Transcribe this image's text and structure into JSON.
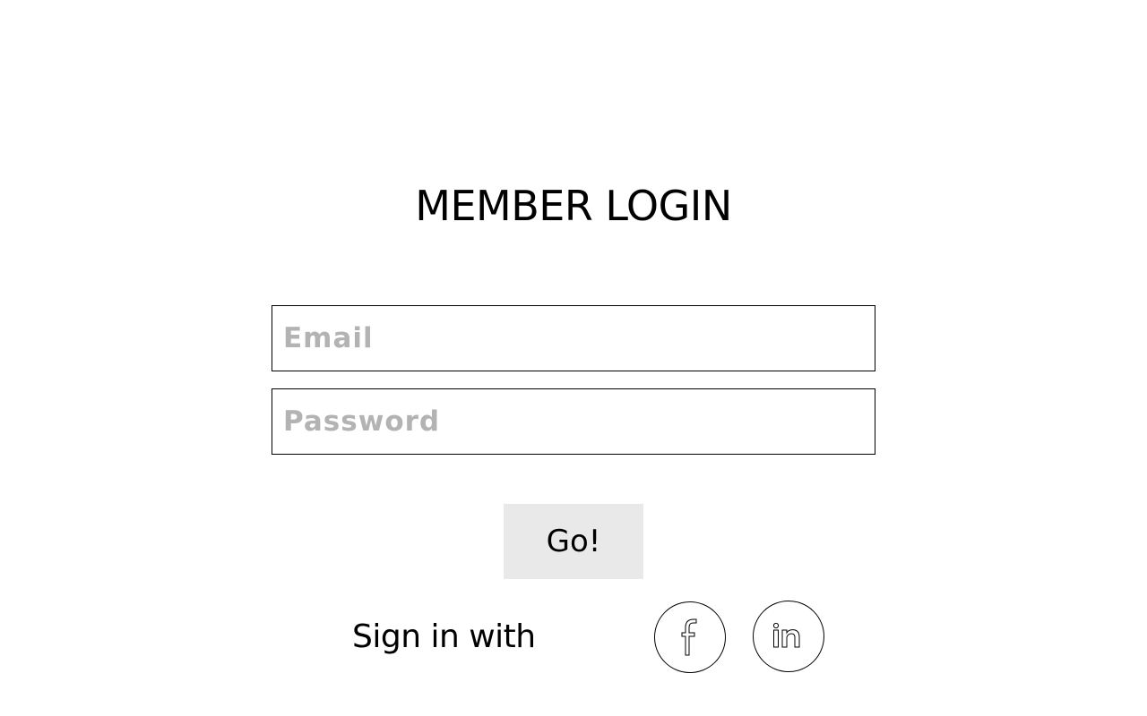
{
  "header": {
    "title": "MEMBER LOGIN"
  },
  "form": {
    "email_placeholder": "Email",
    "password_placeholder": "Password",
    "submit_label": "Go!"
  },
  "social": {
    "label": "Sign in with",
    "providers": [
      {
        "name": "facebook",
        "icon": "facebook-icon"
      },
      {
        "name": "linkedin",
        "icon": "linkedin-icon"
      }
    ]
  }
}
